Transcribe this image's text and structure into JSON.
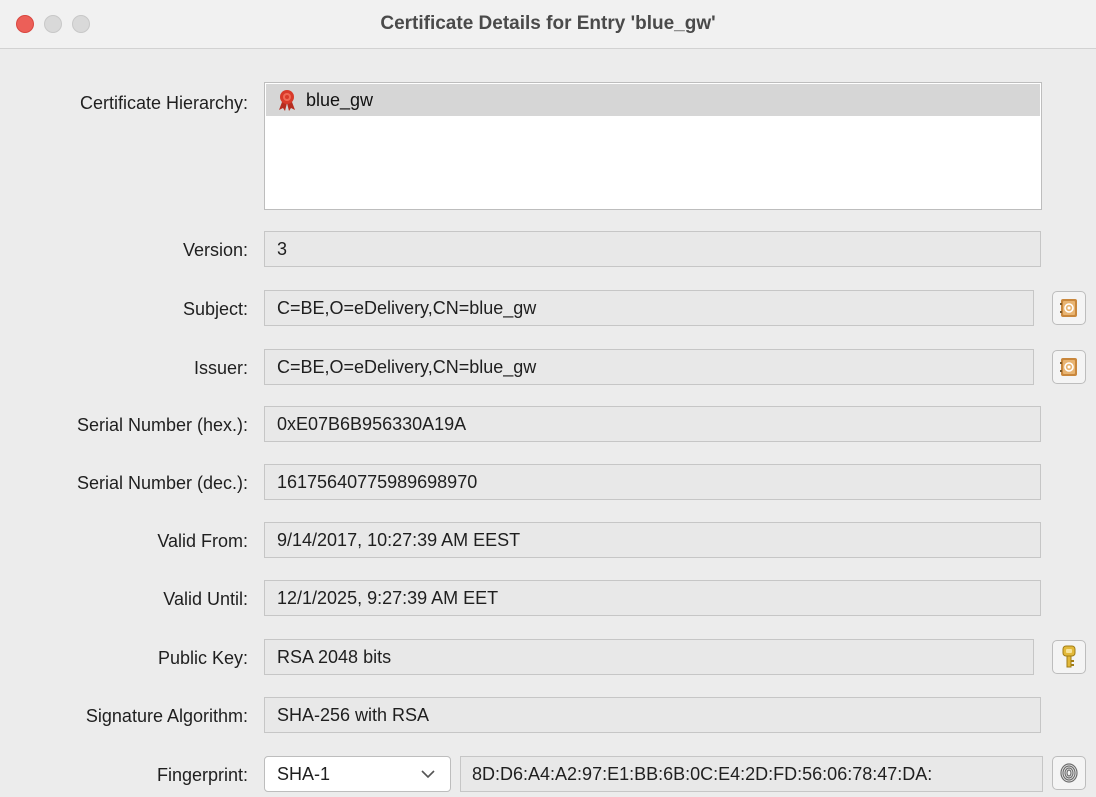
{
  "window": {
    "title": "Certificate Details for Entry 'blue_gw'"
  },
  "hierarchy": {
    "label": "Certificate Hierarchy:",
    "items": [
      {
        "name": "blue_gw",
        "icon": "certificate-ribbon-icon"
      }
    ]
  },
  "fields": {
    "version": {
      "label": "Version:",
      "value": "3"
    },
    "subject": {
      "label": "Subject:",
      "value": "C=BE,O=eDelivery,CN=blue_gw"
    },
    "issuer": {
      "label": "Issuer:",
      "value": "C=BE,O=eDelivery,CN=blue_gw"
    },
    "serial_hex": {
      "label": "Serial Number (hex.):",
      "value": "0xE07B6B956330A19A"
    },
    "serial_dec": {
      "label": "Serial Number (dec.):",
      "value": "16175640775989698970"
    },
    "valid_from": {
      "label": "Valid From:",
      "value": "9/14/2017, 10:27:39 AM EEST"
    },
    "valid_until": {
      "label": "Valid Until:",
      "value": "12/1/2025, 9:27:39 AM EET"
    },
    "public_key": {
      "label": "Public Key:",
      "value": "RSA 2048 bits"
    },
    "signature_algorithm": {
      "label": "Signature Algorithm:",
      "value": "SHA-256 with RSA"
    },
    "fingerprint": {
      "label": "Fingerprint:",
      "algorithm": "SHA-1",
      "value": "8D:D6:A4:A2:97:E1:BB:6B:0C:E4:2D:FD:56:06:78:47:DA:"
    }
  },
  "icons": {
    "subject_button": "address-book-icon",
    "issuer_button": "address-book-icon",
    "public_key_button": "key-icon",
    "fingerprint_button": "fingerprint-icon",
    "fingerprint_combo_arrow": "chevron-down-icon"
  },
  "colors": {
    "close": "#ec5f58",
    "field_bg": "#e8e8e8",
    "selection": "#d6d6d6",
    "ribbon": "#d83a2a"
  }
}
